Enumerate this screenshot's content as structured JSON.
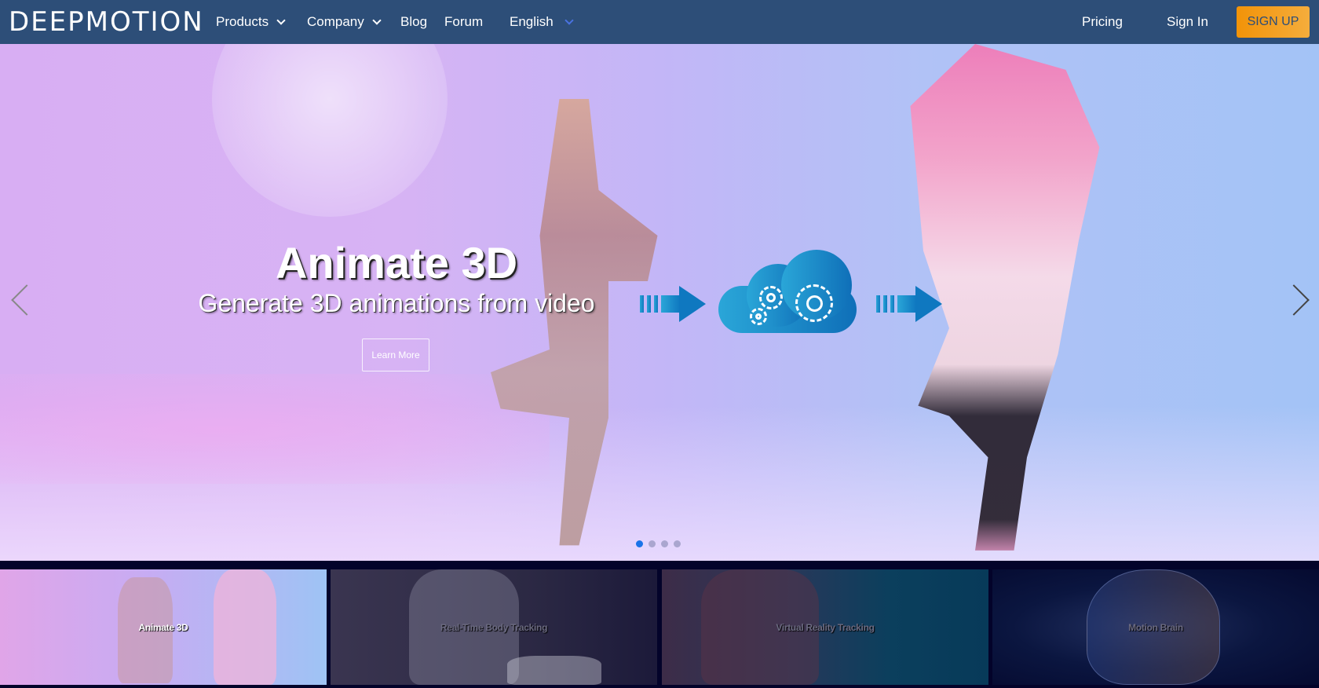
{
  "nav": {
    "logo": "DEEPMOTION",
    "items": [
      {
        "label": "Products",
        "has_dropdown": true
      },
      {
        "label": "Company",
        "has_dropdown": true
      },
      {
        "label": "Blog",
        "has_dropdown": false
      },
      {
        "label": "Forum",
        "has_dropdown": false
      }
    ],
    "language": "English",
    "pricing": "Pricing",
    "sign_in": "Sign In",
    "sign_up": "SIGN UP"
  },
  "hero": {
    "title": "Animate 3D",
    "subtitle": "Generate 3D animations from video",
    "cta": "Learn More",
    "slide_count": 4,
    "active_slide": 1
  },
  "thumbnails": [
    {
      "label": "Animate 3D",
      "active": true
    },
    {
      "label": "Real-Time Body Tracking",
      "active": false
    },
    {
      "label": "Virtual Reality Tracking",
      "active": false
    },
    {
      "label": "Motion Brain",
      "active": false
    }
  ],
  "colors": {
    "nav_bg": "#2d4e78",
    "signup_bg": "#f29308",
    "dot_active": "#1a73e8",
    "strip_bg": "#03032a"
  }
}
